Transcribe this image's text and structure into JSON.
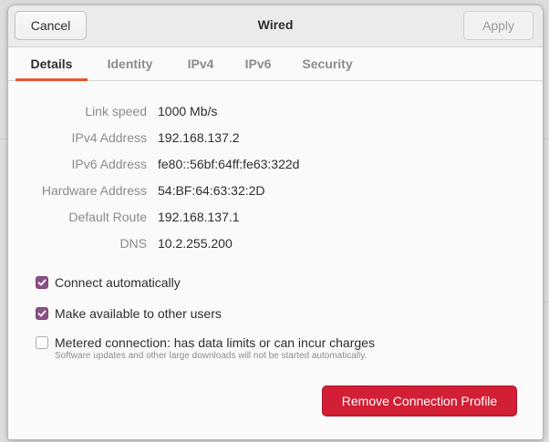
{
  "window": {
    "title": "Wired",
    "cancel_label": "Cancel",
    "apply_label": "Apply"
  },
  "tabs": [
    {
      "label": "Details",
      "active": true
    },
    {
      "label": "Identity",
      "active": false
    },
    {
      "label": "IPv4",
      "active": false
    },
    {
      "label": "IPv6",
      "active": false
    },
    {
      "label": "Security",
      "active": false
    }
  ],
  "details": [
    {
      "label": "Link speed",
      "value": "1000 Mb/s"
    },
    {
      "label": "IPv4 Address",
      "value": "192.168.137.2"
    },
    {
      "label": "IPv6 Address",
      "value": "fe80::56bf:64ff:fe63:322d"
    },
    {
      "label": "Hardware Address",
      "value": "54:BF:64:63:32:2D"
    },
    {
      "label": "Default Route",
      "value": "192.168.137.1"
    },
    {
      "label": "DNS",
      "value": "10.2.255.200"
    }
  ],
  "options": {
    "connect_automatically": {
      "label": "Connect automatically",
      "checked": true
    },
    "available_to_others": {
      "label": "Make available to other users",
      "checked": true
    },
    "metered": {
      "label": "Metered connection: has data limits or can incur charges",
      "sublabel": "Software updates and other large downloads will not be started automatically.",
      "checked": false
    }
  },
  "remove_label": "Remove Connection Profile",
  "colors": {
    "accent_tab_underline": "#e9542a",
    "checkbox_checked": "#8a4f85",
    "destructive_button": "#d21f36"
  },
  "icons": {
    "checkbox_checked": "check-icon"
  }
}
